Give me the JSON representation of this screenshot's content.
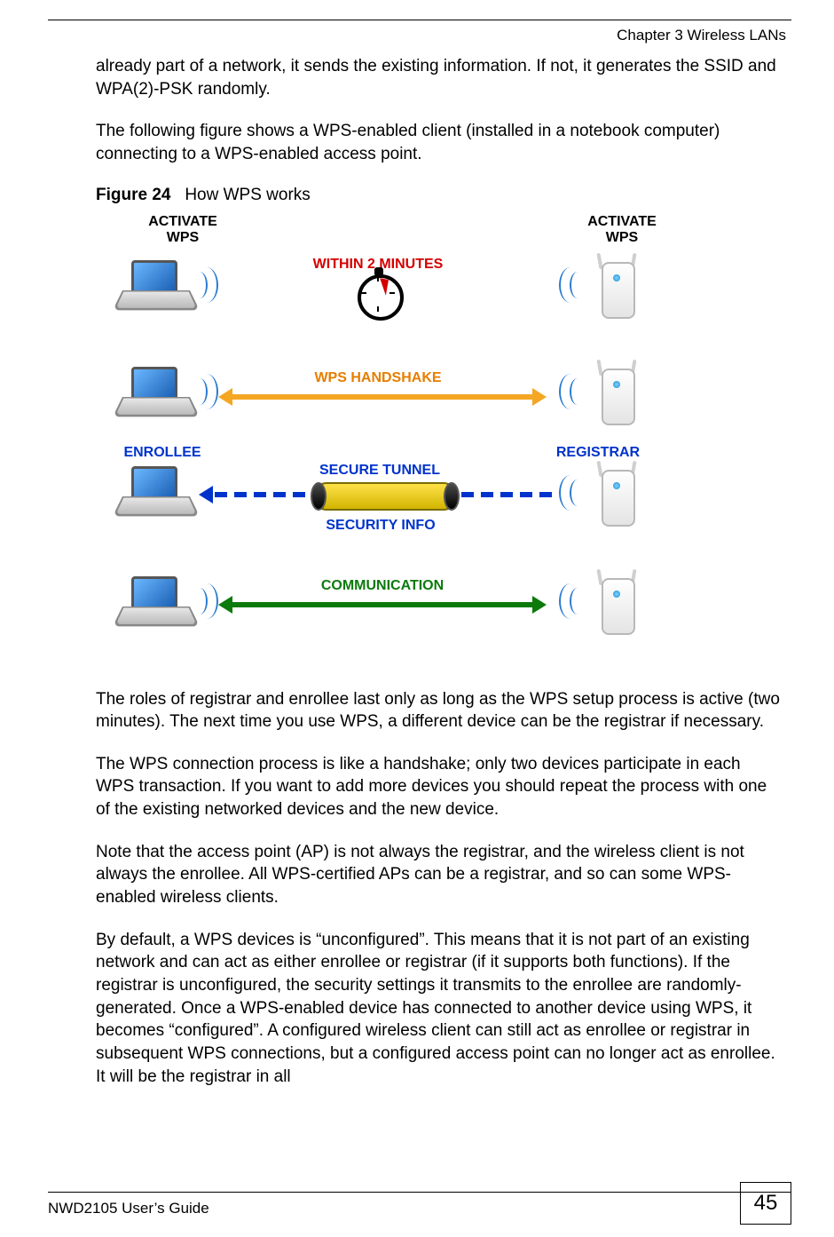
{
  "header": {
    "chapter": "Chapter 3 Wireless LANs"
  },
  "body": {
    "p1": "already part of a network, it sends the existing information. If not, it generates the SSID and WPA(2)-PSK randomly.",
    "p2": "The following figure shows a WPS-enabled client (installed in a notebook computer) connecting to a WPS-enabled access point.",
    "fig_label": "Figure 24",
    "fig_title": "How WPS works",
    "p3": "The roles of registrar and enrollee last only as long as the WPS setup process is active (two minutes). The next time you use WPS, a different device can be the registrar if necessary.",
    "p4": "The WPS connection process is like a handshake; only two devices participate in each WPS transaction. If you want to add more devices you should repeat the process with one of the existing networked devices and the new device.",
    "p5": "Note that the access point (AP) is not always the registrar, and the wireless client is not always the enrollee. All WPS-certified APs can be a registrar, and so can some WPS-enabled wireless clients.",
    "p6": "By default, a WPS devices is “unconfigured”. This means that it is not part of an existing network and can act as either enrollee or registrar (if it supports both functions). If the registrar is unconfigured, the security settings it transmits to the enrollee are randomly-generated. Once a WPS-enabled device has connected to another device using WPS, it becomes “configured”. A configured wireless client can still act as enrollee or registrar in subsequent WPS connections, but a configured access point can no longer act as enrollee. It will be the registrar in all"
  },
  "figure": {
    "activate_left": "ACTIVATE\nWPS",
    "activate_right": "ACTIVATE\nWPS",
    "within": "WITHIN 2 MINUTES",
    "handshake": "WPS HANDSHAKE",
    "enrollee": "ENROLLEE",
    "registrar": "REGISTRAR",
    "secure_tunnel": "SECURE TUNNEL",
    "security_info": "SECURITY INFO",
    "communication": "COMMUNICATION"
  },
  "footer": {
    "guide": "NWD2105 User’s Guide",
    "page": "45"
  }
}
